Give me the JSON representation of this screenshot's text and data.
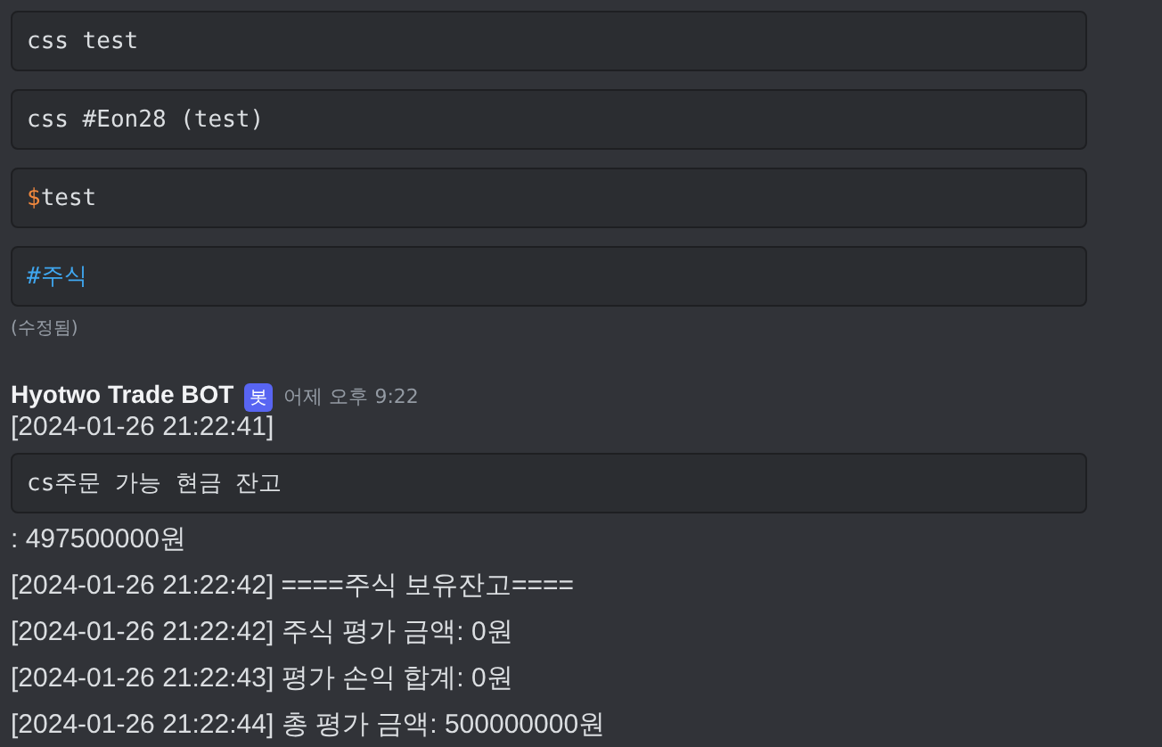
{
  "earlier_message": {
    "code_blocks": [
      {
        "segments": [
          {
            "kind": "plain",
            "text": "css test"
          }
        ]
      },
      {
        "segments": [
          {
            "kind": "plain",
            "text": "css #Eon28 (test)"
          }
        ]
      },
      {
        "segments": [
          {
            "kind": "variable",
            "text": "$"
          },
          {
            "kind": "plain",
            "text": "test"
          }
        ]
      },
      {
        "segments": [
          {
            "kind": "hashtag",
            "text": "#주식"
          }
        ]
      }
    ],
    "edited_label": "(수정됨)"
  },
  "bot_message": {
    "author": "Hyotwo Trade BOT",
    "badge": "봇",
    "timestamp": "어제 오후 9:22",
    "lines": [
      {
        "kind": "text",
        "text": "[2024-01-26 21:22:41]"
      },
      {
        "kind": "code",
        "text": "cs주문 가능 현금 잔고"
      },
      {
        "kind": "text",
        "text": ": 497500000원"
      },
      {
        "kind": "text",
        "text": "[2024-01-26 21:22:42] ====주식 보유잔고===="
      },
      {
        "kind": "text",
        "text": "[2024-01-26 21:22:42] 주식 평가 금액: 0원"
      },
      {
        "kind": "text",
        "text": "[2024-01-26 21:22:43] 평가 손익 합계: 0원"
      },
      {
        "kind": "text",
        "text": "[2024-01-26 21:22:44] 총 평가 금액: 500000000원"
      }
    ]
  }
}
